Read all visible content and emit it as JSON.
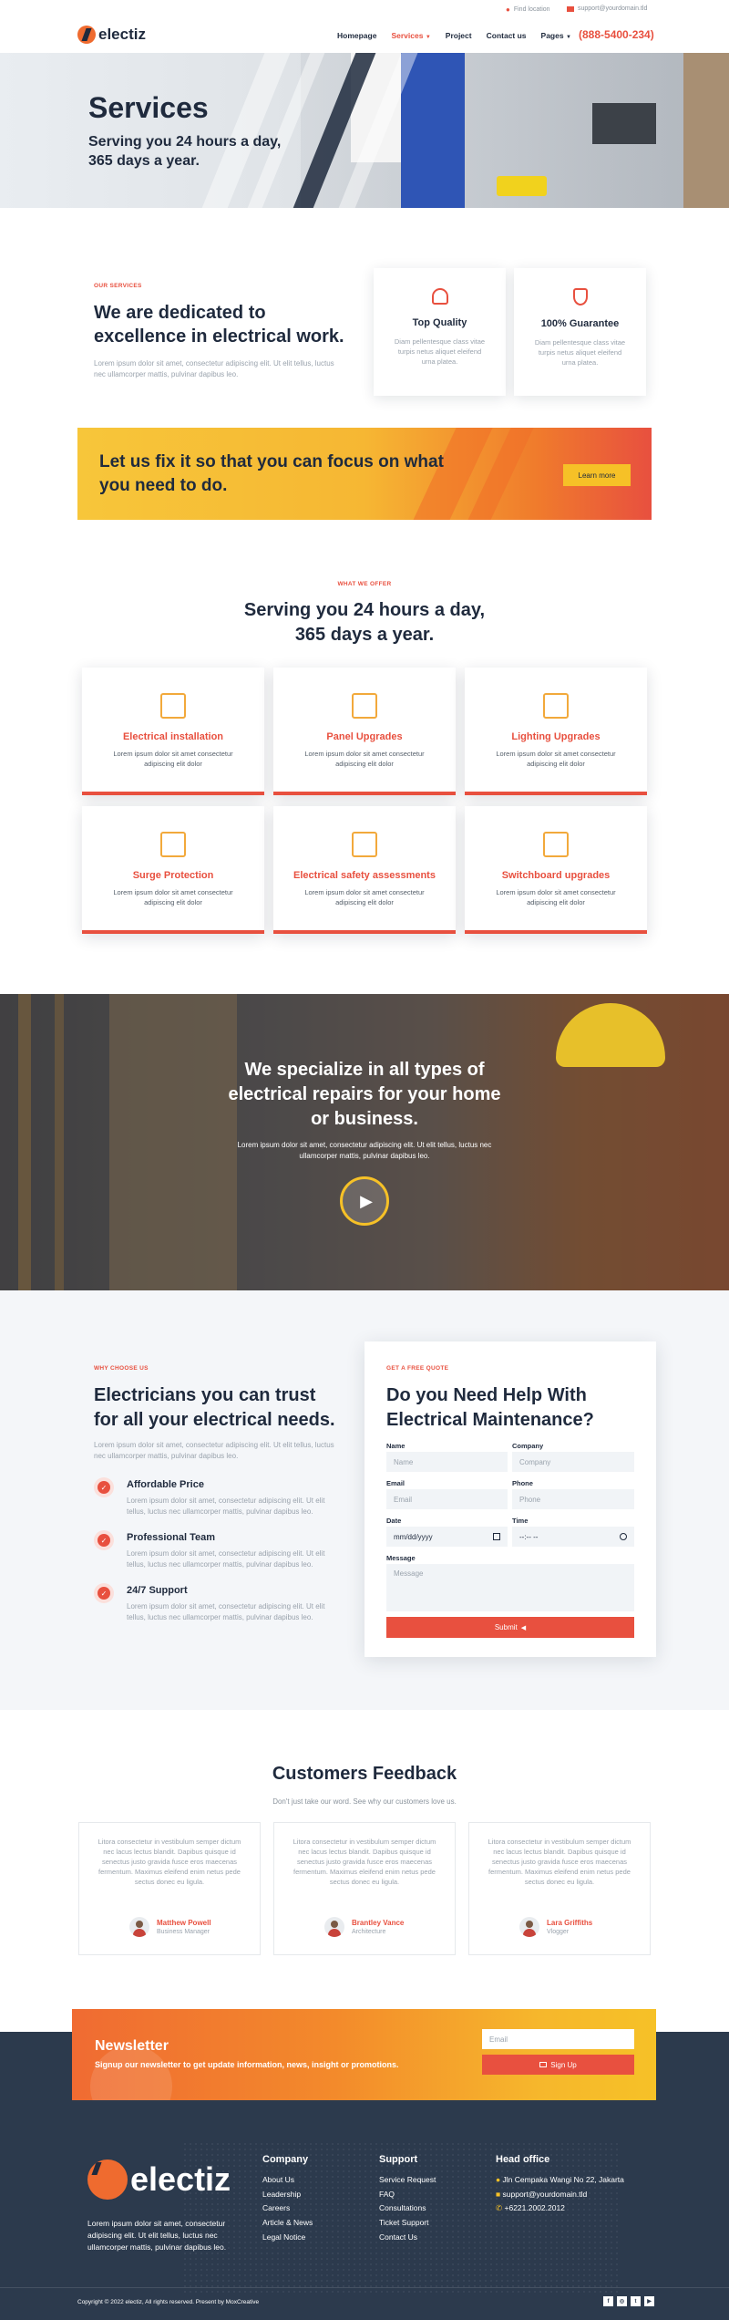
{
  "topbar": {
    "location": "Find location",
    "email": "support@yourdomain.tld"
  },
  "nav": {
    "logo": "electiz",
    "links": [
      "Homepage",
      "Services",
      "Project",
      "Contact us",
      "Pages"
    ],
    "phone": "(888-5400-234)"
  },
  "hero": {
    "title": "Services",
    "subtitle": "Serving you 24 hours a day, 365 days a year."
  },
  "dedicated": {
    "label": "OUR SERVICES",
    "title": "We are dedicated to excellence in electrical work.",
    "text": "Lorem ipsum dolor sit amet, consectetur adipiscing elit. Ut elit tellus, luctus nec ullamcorper mattis, pulvinar dapibus leo.",
    "features": [
      {
        "title": "Top Quality",
        "text": "Diam pellentesque class vitae turpis netus aliquet eleifend urna platea.",
        "icon": "quality-icon"
      },
      {
        "title": "100% Guarantee",
        "text": "Diam pellentesque class vitae turpis netus aliquet eleifend urna platea.",
        "icon": "shield-icon"
      }
    ]
  },
  "cta": {
    "title": "Let us fix it so that you can focus on what you need to do.",
    "button": "Learn more"
  },
  "services": {
    "label": "WHAT WE OFFER",
    "title": "Serving you 24 hours a day, 365 days a year.",
    "items": [
      {
        "title": "Electrical installation",
        "text": "Lorem ipsum dolor sit amet consectetur adipiscing elit dolor",
        "icon": "electrical-panel-icon"
      },
      {
        "title": "Panel Upgrades",
        "text": "Lorem ipsum dolor sit amet consectetur adipiscing elit dolor",
        "icon": "control-panel-icon"
      },
      {
        "title": "Lighting Upgrades",
        "text": "Lorem ipsum dolor sit amet consectetur adipiscing elit dolor",
        "icon": "light-switch-icon"
      },
      {
        "title": "Surge Protection",
        "text": "Lorem ipsum dolor sit amet consectetur adipiscing elit dolor",
        "icon": "surge-protector-icon"
      },
      {
        "title": "Electrical safety assessments",
        "text": "Lorem ipsum dolor sit amet consectetur adipiscing elit dolor",
        "icon": "meter-icon"
      },
      {
        "title": "Switchboard upgrades",
        "text": "Lorem ipsum dolor sit amet consectetur adipiscing elit dolor",
        "icon": "switchboard-icon"
      }
    ]
  },
  "video": {
    "title": "We specialize in all types of electrical repairs for your home or business.",
    "text": "Lorem ipsum dolor sit amet, consectetur adipiscing elit. Ut elit tellus, luctus nec ullamcorper mattis, pulvinar dapibus leo."
  },
  "why": {
    "label": "WHY CHOOSE US",
    "title": "Electricians you can trust for all your electrical needs.",
    "text": "Lorem ipsum dolor sit amet, consectetur adipiscing elit. Ut elit tellus, luctus nec ullamcorper mattis, pulvinar dapibus leo.",
    "items": [
      {
        "title": "Affordable Price",
        "text": "Lorem ipsum dolor sit amet, consectetur adipiscing elit. Ut elit tellus, luctus nec ullamcorper mattis, pulvinar dapibus leo."
      },
      {
        "title": "Professional Team",
        "text": "Lorem ipsum dolor sit amet, consectetur adipiscing elit. Ut elit tellus, luctus nec ullamcorper mattis, pulvinar dapibus leo."
      },
      {
        "title": "24/7 Support",
        "text": "Lorem ipsum dolor sit amet, consectetur adipiscing elit. Ut elit tellus, luctus nec ullamcorper mattis, pulvinar dapibus leo."
      }
    ]
  },
  "form": {
    "label": "GET A FREE QUOTE",
    "title": "Do you Need Help With Electrical Maintenance?",
    "name_label": "Name",
    "name_placeholder": "Name",
    "company_label": "Company",
    "company_placeholder": "Company",
    "email_label": "Email",
    "email_placeholder": "Email",
    "phone_label": "Phone",
    "phone_placeholder": "Phone",
    "date_label": "Date",
    "date_placeholder": "mm/dd/yyyy",
    "time_label": "Time",
    "time_placeholder": "--:-- --",
    "message_label": "Message",
    "message_placeholder": "Message",
    "submit": "Submit"
  },
  "feedback": {
    "title": "Customers Feedback",
    "subtitle": "Don't just take our word. See why our customers love us.",
    "items": [
      {
        "text": "Litora consectetur in vestibulum semper dictum nec lacus lectus blandit. Dapibus quisque id senectus justo gravida fusce eros maecenas fermentum. Maximus eleifend enim netus pede sectus donec eu ligula.",
        "name": "Matthew Powell",
        "role": "Business Manager"
      },
      {
        "text": "Litora consectetur in vestibulum semper dictum nec lacus lectus blandit. Dapibus quisque id senectus justo gravida fusce eros maecenas fermentum. Maximus eleifend enim netus pede sectus donec eu ligula.",
        "name": "Brantley Vance",
        "role": "Architecture"
      },
      {
        "text": "Litora consectetur in vestibulum semper dictum nec lacus lectus blandit. Dapibus quisque id senectus justo gravida fusce eros maecenas fermentum. Maximus eleifend enim netus pede sectus donec eu ligula.",
        "name": "Lara Griffiths",
        "role": "Vlogger"
      }
    ]
  },
  "newsletter": {
    "title": "Newsletter",
    "text": "Signup our newsletter to get update information, news, insight or promotions.",
    "placeholder": "Email",
    "button": "Sign Up"
  },
  "footer": {
    "logo": "electiz",
    "text": "Lorem ipsum dolor sit amet, consectetur adipiscing elit. Ut elit tellus, luctus nec ullamcorper mattis, pulvinar dapibus leo.",
    "company_title": "Company",
    "company_links": [
      "About Us",
      "Leadership",
      "Careers",
      "Article & News",
      "Legal Notice"
    ],
    "support_title": "Support",
    "support_links": [
      "Service Request",
      "FAQ",
      "Consultations",
      "Ticket Support",
      "Contact Us"
    ],
    "office_title": "Head office",
    "address": "Jln Cempaka Wangi No 22, Jakarta",
    "email": "support@yourdomain.tld",
    "phone": "+6221.2002.2012",
    "copyright": "Copyright © 2022 electiz, All rights reserved. Present by MoxCreative",
    "social": [
      "f",
      "◎",
      "t",
      "▶"
    ]
  },
  "colors": {
    "accent": "#e8503f",
    "yellow": "#f6c127",
    "dark": "#2c3a4d"
  }
}
